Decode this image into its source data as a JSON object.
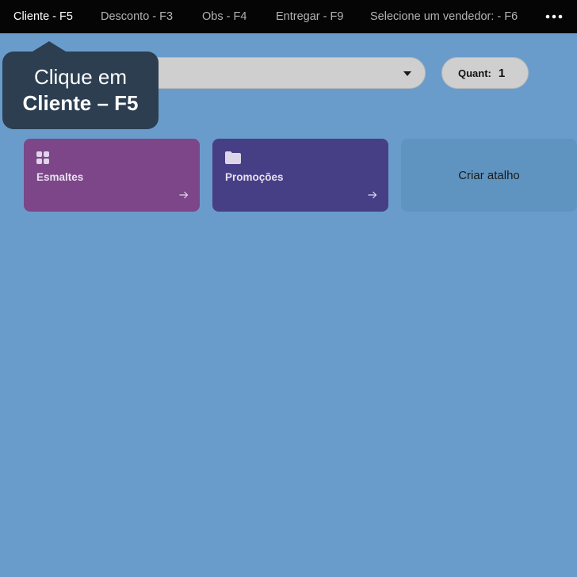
{
  "topbar": {
    "tabs": [
      {
        "label": "Cliente - F5",
        "active": true
      },
      {
        "label": "Desconto - F3",
        "active": false
      },
      {
        "label": "Obs - F4",
        "active": false
      },
      {
        "label": "Entregar - F9",
        "active": false
      },
      {
        "label": "Selecione um vendedor: - F6",
        "active": false
      }
    ],
    "more_icon": "more-horizontal-icon"
  },
  "product_select": {
    "value": "",
    "icon": "caret-down-icon"
  },
  "quantity": {
    "label": "Quant:",
    "value": "1"
  },
  "tooltip": {
    "line1": "Clique em",
    "line2": "Cliente – F5"
  },
  "shortcuts": [
    {
      "label": "Esmaltes",
      "icon": "grid-icon",
      "color": "#7c4688"
    },
    {
      "label": "Promoções",
      "icon": "folder-icon",
      "color": "#463f86"
    }
  ],
  "create_shortcut": {
    "label": "Criar atalho"
  },
  "colors": {
    "background": "#6a9ccb",
    "topbar": "#050505",
    "tooltip": "#2c3e50"
  }
}
